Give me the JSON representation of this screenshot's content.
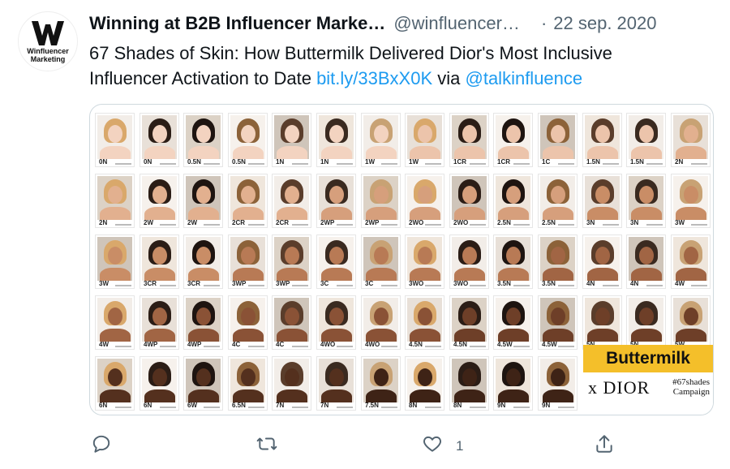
{
  "tweet": {
    "avatar_text": "Winfluencer Marketing",
    "name": "Winning at B2B Influencer Marke…",
    "handle": "@winfluencer…",
    "separator": "·",
    "date": "22 sep. 2020",
    "text_line1": "67 Shades of Skin: How Buttermilk Delivered Dior's Most Inclusive",
    "text_line2_prefix": "Influencer Activation to Date ",
    "link": "bit.ly/33BxX0K",
    "via": " via ",
    "mention": "@talkinfluence"
  },
  "media": {
    "shades": [
      [
        "0N",
        "0N",
        "0.5N",
        "0.5N",
        "1N",
        "1N",
        "1W",
        "1W",
        "1CR",
        "1CR",
        "1C",
        "1.5N",
        "1.5N",
        "2N"
      ],
      [
        "2N",
        "2W",
        "2W",
        "2CR",
        "2CR",
        "2WP",
        "2WP",
        "2WO",
        "2WO",
        "2.5N",
        "2.5N",
        "3N",
        "3N",
        "3W"
      ],
      [
        "3W",
        "3CR",
        "3CR",
        "3WP",
        "3WP",
        "3C",
        "3C",
        "3WO",
        "3WO",
        "3.5N",
        "3.5N",
        "4N",
        "4N",
        "4W"
      ],
      [
        "4W",
        "4WP",
        "4WP",
        "4C",
        "4C",
        "4WO",
        "4WO",
        "4.5N",
        "4.5N",
        "4.5W",
        "4.5W",
        "5N",
        "5N",
        "5W"
      ],
      [
        "6N",
        "6N",
        "6W",
        "6.5N",
        "7N",
        "7N",
        "7.5N",
        "8N",
        "8N",
        "9N",
        "9N"
      ]
    ],
    "brand_name": "Buttermilk",
    "collab": "x DIOR",
    "campaign": "#67shades Campaign"
  },
  "actions": {
    "like_count": "1"
  }
}
